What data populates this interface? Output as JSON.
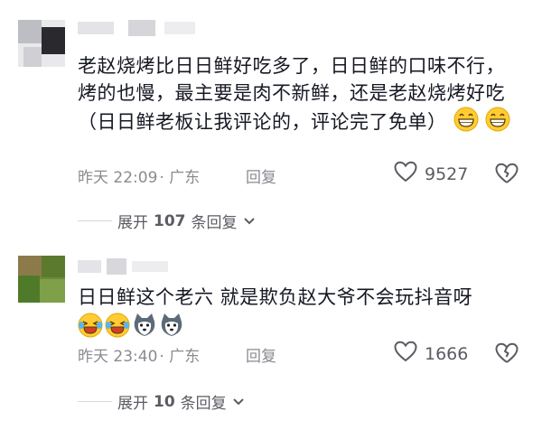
{
  "comments": [
    {
      "text": "老赵烧烤比日日鲜好吃多了，日日鲜的口味不行，烤的也慢，最主要是肉不新鲜，还是老赵烧烤好吃（日日鲜老板让我评论的，评论完了免单）",
      "emojis": [
        "grin-emoji",
        "grin-emoji"
      ],
      "time": "昨天 22:09",
      "location": "· 广东",
      "reply_label": "回复",
      "likes": "9527",
      "expand_prefix": "展开",
      "expand_count": "107",
      "expand_suffix": "条回复"
    },
    {
      "text": "日日鲜这个老六 就是欺负赵大爷不会玩抖音呀",
      "emojis": [
        "laugh-cry-emoji",
        "laugh-cry-emoji",
        "husky-emoji",
        "husky-emoji"
      ],
      "time": "昨天 23:40",
      "location": "· 广东",
      "reply_label": "回复",
      "likes": "1666",
      "expand_prefix": "展开",
      "expand_count": "10",
      "expand_suffix": "条回复"
    }
  ],
  "colors": {
    "text": "#161823",
    "meta": "#8a8b91",
    "accent": "#f5c518"
  }
}
